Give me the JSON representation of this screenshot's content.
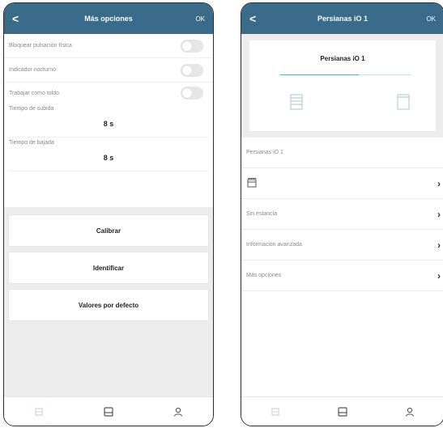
{
  "left_screen": {
    "back_glyph": "<",
    "title": "Más opciones",
    "ok_label": "OK",
    "toggles": [
      {
        "label": "Bloquear pulsación física",
        "on": false
      },
      {
        "label": "Indicador nocturno",
        "on": false
      },
      {
        "label": "Trabajar como toldo",
        "on": false
      }
    ],
    "rise_time": {
      "label": "Tiempo de subida",
      "value": "8 s"
    },
    "fall_time": {
      "label": "Tiempo de bajada",
      "value": "8 s"
    },
    "buttons": {
      "calibrate": "Calibrar",
      "identify": "Identificar",
      "defaults": "Valores por defecto"
    }
  },
  "right_screen": {
    "back_glyph": "<",
    "title": "Persianas iO 1",
    "ok_label": "OK",
    "device_title": "Persianas iO 1",
    "list": {
      "name_row": "Persianas iO 1",
      "room_row": "Sin estancia",
      "advanced_row": "Información avanzada",
      "more_row": "Más opciones"
    }
  },
  "tabbar_icons": [
    "grid-icon",
    "device-icon",
    "user-icon"
  ],
  "colors": {
    "navbar": "#3a6b8a",
    "accent": "#6aa7c7",
    "background_gray": "#ececec"
  }
}
